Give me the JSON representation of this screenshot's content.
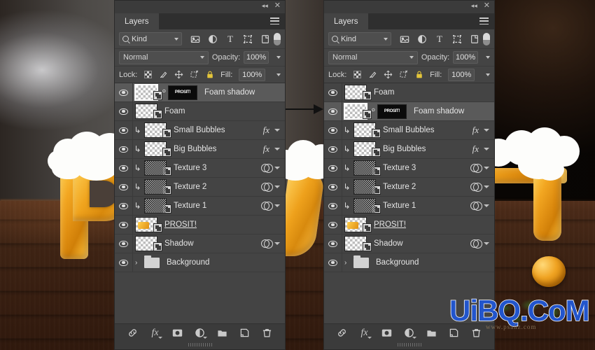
{
  "app": "Adobe Photoshop Layers Panel Comparison",
  "panels": [
    {
      "id": "left",
      "titlebar": {
        "collapse_icon": "double-chevron-left-icon",
        "close_icon": "close-icon"
      },
      "tab": {
        "label": "Layers",
        "menu_icon": "panel-menu-icon"
      },
      "filter": {
        "search_icon": "search-icon",
        "kind_value": "Kind",
        "icons": [
          "pixel-filter-icon",
          "adjustment-filter-icon",
          "type-filter-icon",
          "shape-filter-icon",
          "smart-object-filter-icon"
        ],
        "toggle": "filter-enable-toggle"
      },
      "blend": {
        "mode": "Normal",
        "opacity_label": "Opacity:",
        "opacity_value": "100%"
      },
      "lock": {
        "label": "Lock:",
        "icons": [
          "lock-transparent-pixels-icon",
          "lock-image-pixels-icon",
          "lock-position-icon",
          "lock-artboard-nesting-icon",
          "lock-all-icon"
        ],
        "fill_label": "Fill:",
        "fill_value": "100%"
      },
      "layers": [
        {
          "name": "Foam shadow",
          "selected": true,
          "visible": true,
          "thumb": "transparent",
          "thumb_selected": true,
          "link_icon": "link-icon",
          "mask": "PROSIT!",
          "clipped": false,
          "right_icons": []
        },
        {
          "name": "Foam",
          "selected": false,
          "visible": true,
          "thumb": "transparent",
          "clipped": false,
          "right_icons": []
        },
        {
          "name": "Small Bubbles",
          "selected": false,
          "visible": true,
          "thumb": "transparent",
          "clipped": true,
          "right_icons": [
            "fx",
            "chevron"
          ]
        },
        {
          "name": "Big Bubbles",
          "selected": false,
          "visible": true,
          "thumb": "transparent-dots",
          "clipped": true,
          "right_icons": [
            "fx",
            "chevron"
          ]
        },
        {
          "name": "Texture 3",
          "selected": false,
          "visible": true,
          "thumb": "noise",
          "clipped": true,
          "right_icons": [
            "adjustment",
            "chevron"
          ]
        },
        {
          "name": "Texture 2",
          "selected": false,
          "visible": true,
          "thumb": "noise",
          "clipped": true,
          "right_icons": [
            "adjustment",
            "chevron"
          ]
        },
        {
          "name": "Texture 1",
          "selected": false,
          "visible": true,
          "thumb": "noise",
          "clipped": true,
          "right_icons": [
            "adjustment",
            "chevron"
          ]
        },
        {
          "name": "PROSIT!",
          "selected": false,
          "visible": true,
          "thumb": "glyph",
          "underline": true,
          "clipped": false,
          "right_icons": []
        },
        {
          "name": "Shadow",
          "selected": false,
          "visible": true,
          "thumb": "transparent",
          "clipped": false,
          "right_icons": [
            "adjustment",
            "chevron"
          ]
        },
        {
          "name": "Background",
          "selected": false,
          "visible": true,
          "thumb": "folder",
          "clipped": false,
          "right_icons": []
        }
      ],
      "bottombar": [
        "link-layers-icon",
        "layer-style-fx-icon",
        "add-layer-mask-icon",
        "new-adjustment-layer-icon",
        "new-group-icon",
        "new-layer-icon",
        "delete-layer-icon"
      ]
    },
    {
      "id": "right",
      "titlebar": {
        "collapse_icon": "double-chevron-left-icon",
        "close_icon": "close-icon"
      },
      "tab": {
        "label": "Layers",
        "menu_icon": "panel-menu-icon"
      },
      "filter": {
        "search_icon": "search-icon",
        "kind_value": "Kind",
        "icons": [
          "pixel-filter-icon",
          "adjustment-filter-icon",
          "type-filter-icon",
          "shape-filter-icon",
          "smart-object-filter-icon"
        ],
        "toggle": "filter-enable-toggle"
      },
      "blend": {
        "mode": "Normal",
        "opacity_label": "Opacity:",
        "opacity_value": "100%"
      },
      "lock": {
        "label": "Lock:",
        "icons": [
          "lock-transparent-pixels-icon",
          "lock-image-pixels-icon",
          "lock-position-icon",
          "lock-artboard-nesting-icon",
          "lock-all-icon"
        ],
        "fill_label": "Fill:",
        "fill_value": "100%"
      },
      "layers": [
        {
          "name": "Foam",
          "selected": false,
          "visible": true,
          "thumb": "transparent",
          "clipped": false,
          "right_icons": []
        },
        {
          "name": "Foam shadow",
          "selected": true,
          "visible": true,
          "thumb": "transparent",
          "thumb_selected": true,
          "link_icon": "link-icon",
          "mask": "PROSIT!",
          "clipped": false,
          "right_icons": []
        },
        {
          "name": "Small Bubbles",
          "selected": false,
          "visible": true,
          "thumb": "transparent",
          "clipped": true,
          "right_icons": [
            "fx",
            "chevron"
          ]
        },
        {
          "name": "Big Bubbles",
          "selected": false,
          "visible": true,
          "thumb": "transparent-dots",
          "clipped": true,
          "right_icons": [
            "fx",
            "chevron"
          ]
        },
        {
          "name": "Texture 3",
          "selected": false,
          "visible": true,
          "thumb": "noise",
          "clipped": true,
          "right_icons": [
            "adjustment",
            "chevron"
          ]
        },
        {
          "name": "Texture 2",
          "selected": false,
          "visible": true,
          "thumb": "noise",
          "clipped": true,
          "right_icons": [
            "adjustment",
            "chevron"
          ]
        },
        {
          "name": "Texture 1",
          "selected": false,
          "visible": true,
          "thumb": "noise",
          "clipped": true,
          "right_icons": [
            "adjustment",
            "chevron"
          ]
        },
        {
          "name": "PROSIT!",
          "selected": false,
          "visible": true,
          "thumb": "glyph",
          "underline": true,
          "clipped": false,
          "right_icons": []
        },
        {
          "name": "Shadow",
          "selected": false,
          "visible": true,
          "thumb": "transparent",
          "clipped": false,
          "right_icons": [
            "adjustment",
            "chevron"
          ]
        },
        {
          "name": "Background",
          "selected": false,
          "visible": true,
          "thumb": "folder",
          "clipped": false,
          "right_icons": []
        }
      ],
      "bottombar": [
        "link-layers-icon",
        "layer-style-fx-icon",
        "add-layer-mask-icon",
        "new-adjustment-layer-icon",
        "new-group-icon",
        "new-layer-icon",
        "delete-layer-icon"
      ]
    }
  ],
  "annotation": {
    "arrow": "right-arrow-annotation"
  },
  "watermark": {
    "text": "UiBQ.CoM",
    "subtext": "www.psahz.com",
    "color": "#2255cc"
  },
  "background_photo": {
    "description": "Blurred bar interior with wooden table and golden beer-letters topped with foam",
    "letters_visible": [
      "P",
      "S",
      "I",
      "!"
    ]
  }
}
